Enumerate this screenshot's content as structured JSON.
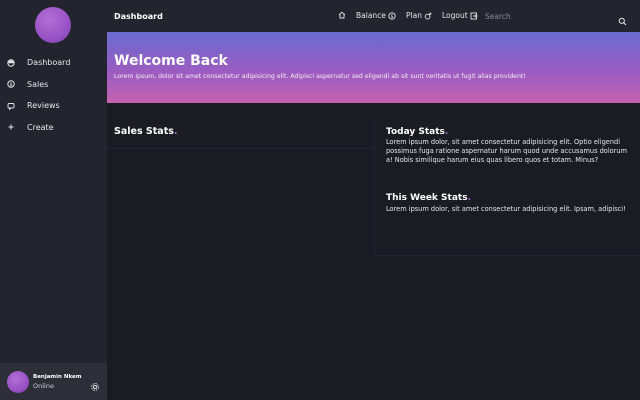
{
  "sidebar": {
    "items": [
      {
        "label": "Dashboard",
        "icon": "dashboard-icon"
      },
      {
        "label": "Sales",
        "icon": "dollar-icon"
      },
      {
        "label": "Reviews",
        "icon": "chat-icon"
      },
      {
        "label": "Create",
        "icon": "plus-icon"
      }
    ],
    "profile": {
      "name": "Benjamin Nkem",
      "status": "Online"
    }
  },
  "topbar": {
    "title": "Dashboard",
    "nav": {
      "balance": "Balance",
      "plan": "Plan",
      "logout": "Logout"
    },
    "search_placeholder": "Search"
  },
  "banner": {
    "title": "Welcome Back",
    "text": "Lorem ipsum, dolor sit amet consectetur adipisicing elit. Adipisci aspernatur sed eligendi ab sit sunt veritatis ut fugit alias provident!"
  },
  "sales_stats": {
    "title": "Sales Stats",
    "dot": "."
  },
  "today_stats": {
    "title": "Today Stats",
    "dot": ".",
    "text": "Lorem ipsum dolor, sit amet consectetur adipisicing elit. Optio eligendi possimus fuga ratione aspernatur harum quod unde accusamus dolorum a! Nobis similique harum eius quas libero quos et totam. Minus?"
  },
  "week_stats": {
    "title": "This Week Stats",
    "dot": ".",
    "text": "Lorem ipsum dolor, sit amet consectetur adipisicing elit. Ipsam, adipisci!"
  },
  "colors": {
    "accent": "#a86bd8",
    "background": "#1b1c23",
    "panel": "#23242d"
  }
}
